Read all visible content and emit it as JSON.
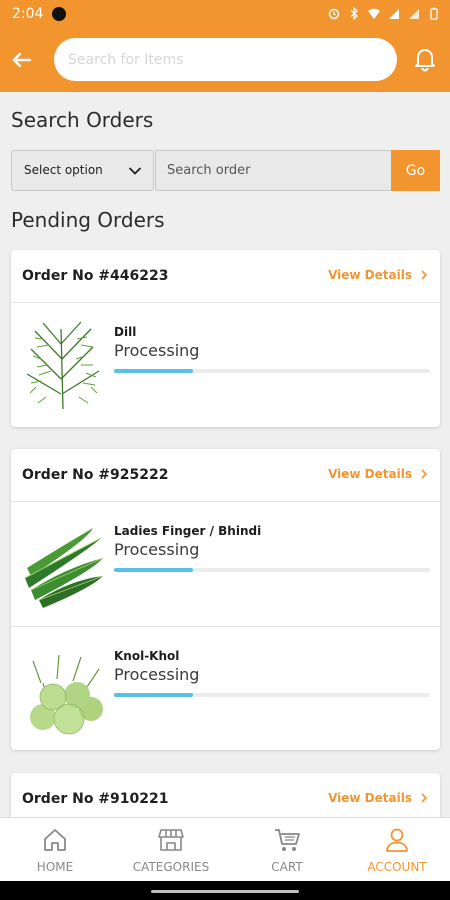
{
  "status_bar": {
    "time": "2:04"
  },
  "header": {
    "search_placeholder": "Search for Items"
  },
  "search_orders": {
    "title": "Search Orders",
    "select_label": "Select option",
    "order_placeholder": "Search order",
    "go_label": "Go"
  },
  "pending": {
    "title": "Pending Orders",
    "orders": [
      {
        "order_no": "Order No #446223",
        "view_label": "View Details",
        "items": [
          {
            "name": "Dill",
            "status": "Processing",
            "progress": 0.25,
            "icon": "dill-image"
          }
        ]
      },
      {
        "order_no": "Order No #925222",
        "view_label": "View Details",
        "items": [
          {
            "name": "Ladies Finger / Bhindi",
            "status": "Processing",
            "progress": 0.25,
            "icon": "okra-image"
          },
          {
            "name": "Knol-Khol",
            "status": "Processing",
            "progress": 0.25,
            "icon": "kohlrabi-image"
          }
        ]
      },
      {
        "order_no": "Order No #910221",
        "view_label": "View Details",
        "items": []
      }
    ]
  },
  "nav": {
    "home": "HOME",
    "categories": "CATEGORIES",
    "cart": "CART",
    "account": "ACCOUNT",
    "active": "account"
  },
  "colors": {
    "accent": "#f3952f",
    "progress": "#5bbfe5"
  }
}
